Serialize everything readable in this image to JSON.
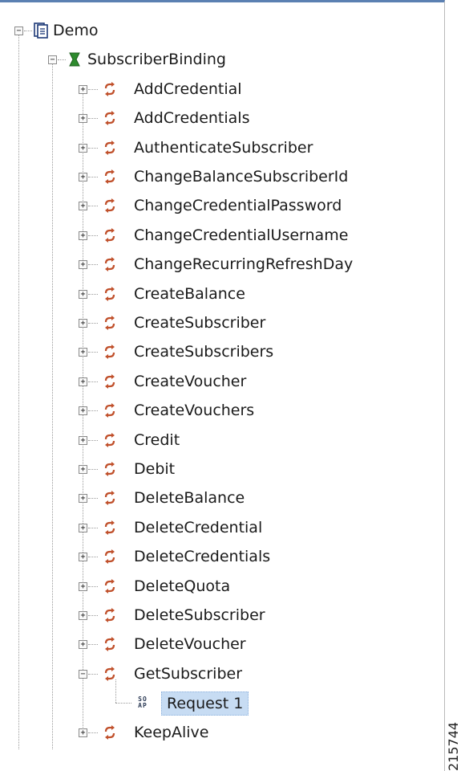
{
  "tree": {
    "root": {
      "label": "Demo"
    },
    "binding": {
      "label": "SubscriberBinding"
    },
    "operations": [
      "AddCredential",
      "AddCredentials",
      "AuthenticateSubscriber",
      "ChangeBalanceSubscriberId",
      "ChangeCredentialPassword",
      "ChangeCredentialUsername",
      "ChangeRecurringRefreshDay",
      "CreateBalance",
      "CreateSubscriber",
      "CreateSubscribers",
      "CreateVoucher",
      "CreateVouchers",
      "Credit",
      "Debit",
      "DeleteBalance",
      "DeleteCredential",
      "DeleteCredentials",
      "DeleteQuota",
      "DeleteSubscriber",
      "DeleteVoucher",
      "GetSubscriber"
    ],
    "expanded_operation": "GetSubscriber",
    "request": {
      "label": "Request 1",
      "icon_text_top": "SO",
      "icon_text_bottom": "AP"
    },
    "after_request": [
      "KeepAlive"
    ]
  },
  "figure_number": "215744",
  "colors": {
    "selection": "#c7dcf3",
    "operation_icon": "#c0502b",
    "binding_icon": "#2e8b2e",
    "header_accent": "#5b80b2"
  },
  "icons": {
    "root": "project-icon",
    "binding": "interface-icon",
    "operation": "operation-arrows-icon",
    "request": "soap-request-icon",
    "expand": "plus-box-icon",
    "collapse": "minus-box-icon"
  }
}
